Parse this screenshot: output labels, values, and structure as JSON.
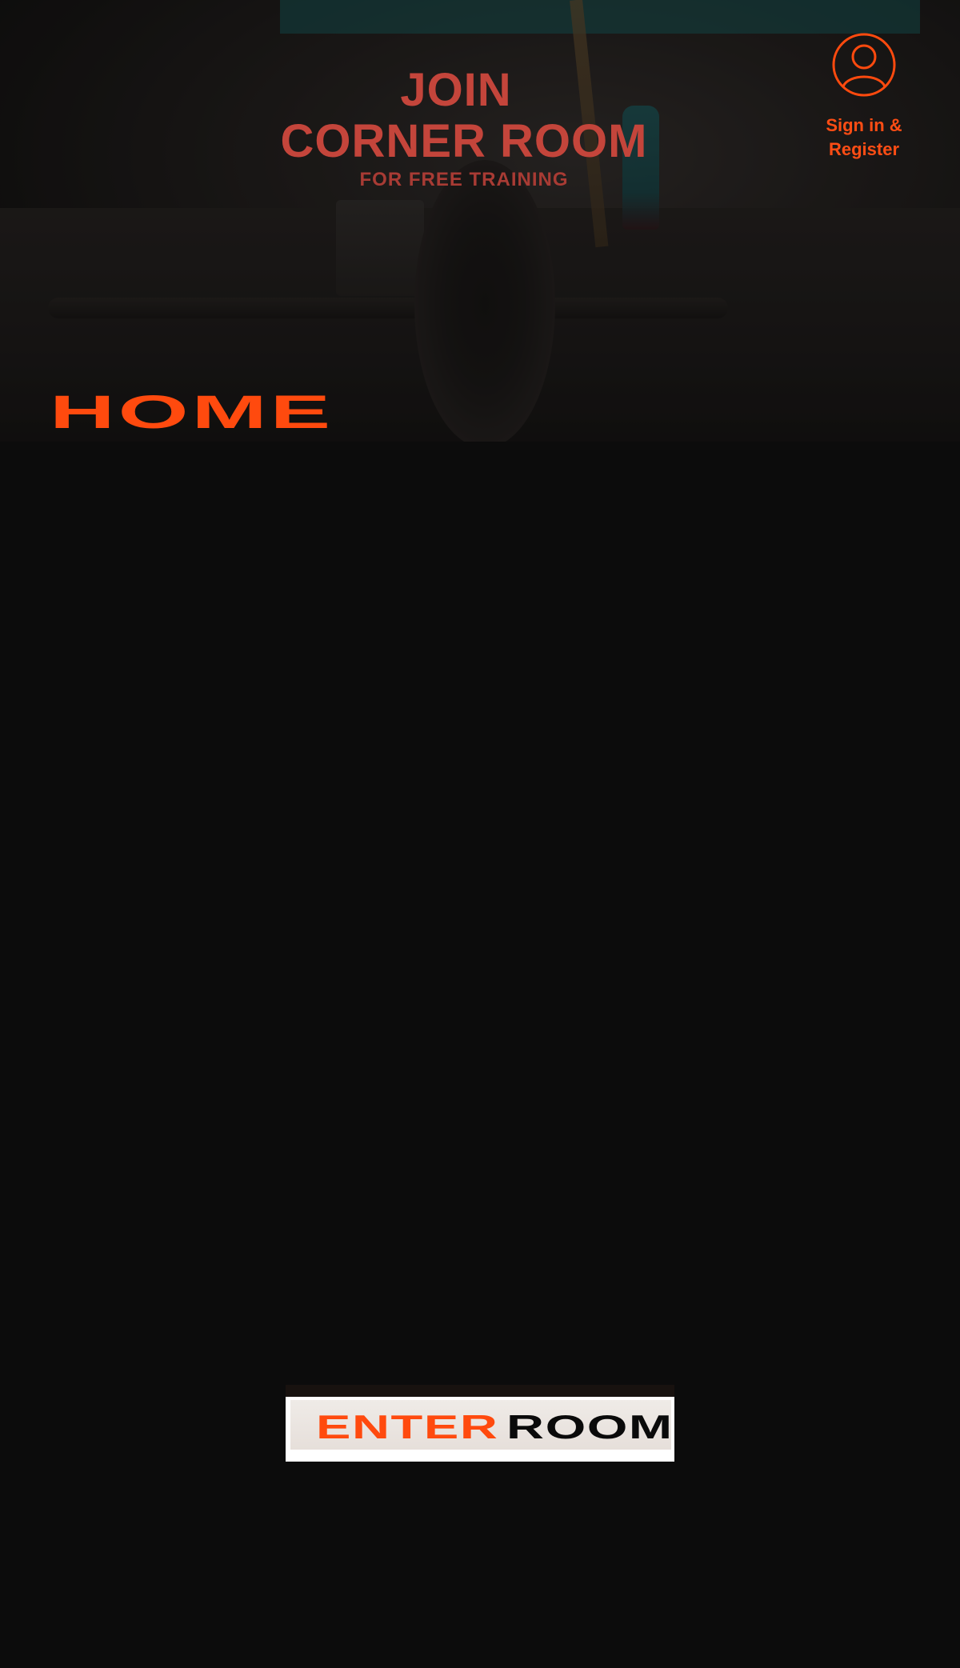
{
  "hero": {
    "title_line1": "JOIN",
    "title_line2": "CORNER ROOM",
    "subtitle": "FOR FREE TRAINING"
  },
  "account": {
    "icon": "user-circle-icon",
    "label": "Sign in & Register"
  },
  "page_label": "HOME",
  "cta": {
    "word1": "ENTER",
    "word2": "ROOM"
  },
  "colors": {
    "accent": "#ff4a0e",
    "headline": "#c4453b",
    "background": "#0c0c0c"
  }
}
